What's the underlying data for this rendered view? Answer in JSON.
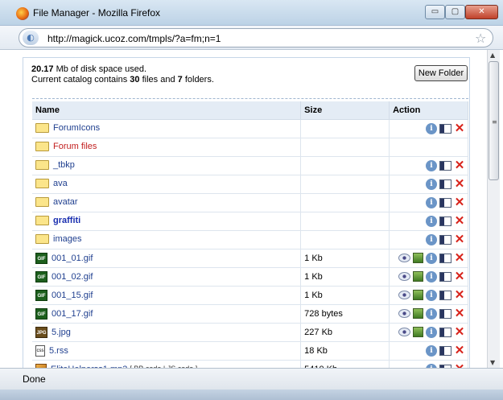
{
  "window": {
    "title": "File Manager - Mozilla Firefox",
    "min_label": "▭",
    "max_label": "▢",
    "close_label": "✕"
  },
  "address": {
    "url": "http://magick.ucoz.com/tmpls/?a=fm;n=1"
  },
  "info": {
    "used_amount": "20.17",
    "used_suffix": " Mb of disk space used.",
    "catalog_prefix": "Current catalog contains ",
    "files_count": "30",
    "files_mid": " files and ",
    "folders_count": "7",
    "folders_suffix": " folders."
  },
  "toolbar": {
    "new_folder_label": "New Folder"
  },
  "table": {
    "headers": {
      "name": "Name",
      "size": "Size",
      "action": "Action"
    },
    "rows": [
      {
        "name": "ForumIcons",
        "size": "",
        "type": "folder",
        "style": "normal",
        "actions": [
          "info",
          "rename",
          "delete"
        ]
      },
      {
        "name": "Forum files",
        "size": "",
        "type": "folder",
        "style": "red",
        "actions": []
      },
      {
        "name": "_tbkp",
        "size": "",
        "type": "folder",
        "style": "normal",
        "actions": [
          "info",
          "rename",
          "delete"
        ]
      },
      {
        "name": "ava",
        "size": "",
        "type": "folder",
        "style": "normal",
        "actions": [
          "info",
          "rename",
          "delete"
        ]
      },
      {
        "name": "avatar",
        "size": "",
        "type": "folder",
        "style": "normal",
        "actions": [
          "info",
          "rename",
          "delete"
        ]
      },
      {
        "name": "graffiti",
        "size": "",
        "type": "folder",
        "style": "bold",
        "actions": [
          "info",
          "rename",
          "delete"
        ]
      },
      {
        "name": "images",
        "size": "",
        "type": "folder",
        "style": "normal",
        "actions": [
          "info",
          "rename",
          "delete"
        ]
      },
      {
        "name": "001_01.gif",
        "size": "1 Kb",
        "type": "gif",
        "style": "normal",
        "actions": [
          "view",
          "image",
          "info",
          "rename",
          "delete"
        ]
      },
      {
        "name": "001_02.gif",
        "size": "1 Kb",
        "type": "gif",
        "style": "normal",
        "actions": [
          "view",
          "image",
          "info",
          "rename",
          "delete"
        ]
      },
      {
        "name": "001_15.gif",
        "size": "1 Kb",
        "type": "gif",
        "style": "normal",
        "actions": [
          "view",
          "image",
          "info",
          "rename",
          "delete"
        ]
      },
      {
        "name": "001_17.gif",
        "size": "728 bytes",
        "type": "gif",
        "style": "normal",
        "actions": [
          "view",
          "image",
          "info",
          "rename",
          "delete"
        ]
      },
      {
        "name": "5.jpg",
        "size": "227 Kb",
        "type": "jpg",
        "style": "normal",
        "actions": [
          "view",
          "image",
          "info",
          "rename",
          "delete"
        ]
      },
      {
        "name": "5.rss",
        "size": "18 Kb",
        "type": "rss",
        "style": "normal",
        "actions": [
          "info",
          "rename",
          "delete"
        ]
      },
      {
        "name": "EliteHelperss1.mp3",
        "extra": "[ BB code | JS code ]",
        "size": "5410 Kb",
        "type": "mp3",
        "style": "normal",
        "actions": [
          "info",
          "rename",
          "delete"
        ]
      }
    ]
  },
  "icons": {
    "gif_label": "GIF",
    "jpg_label": "JPG",
    "rss_label": "css",
    "info_glyph": "i",
    "delete_glyph": "✕"
  },
  "status": {
    "text": "Done"
  }
}
